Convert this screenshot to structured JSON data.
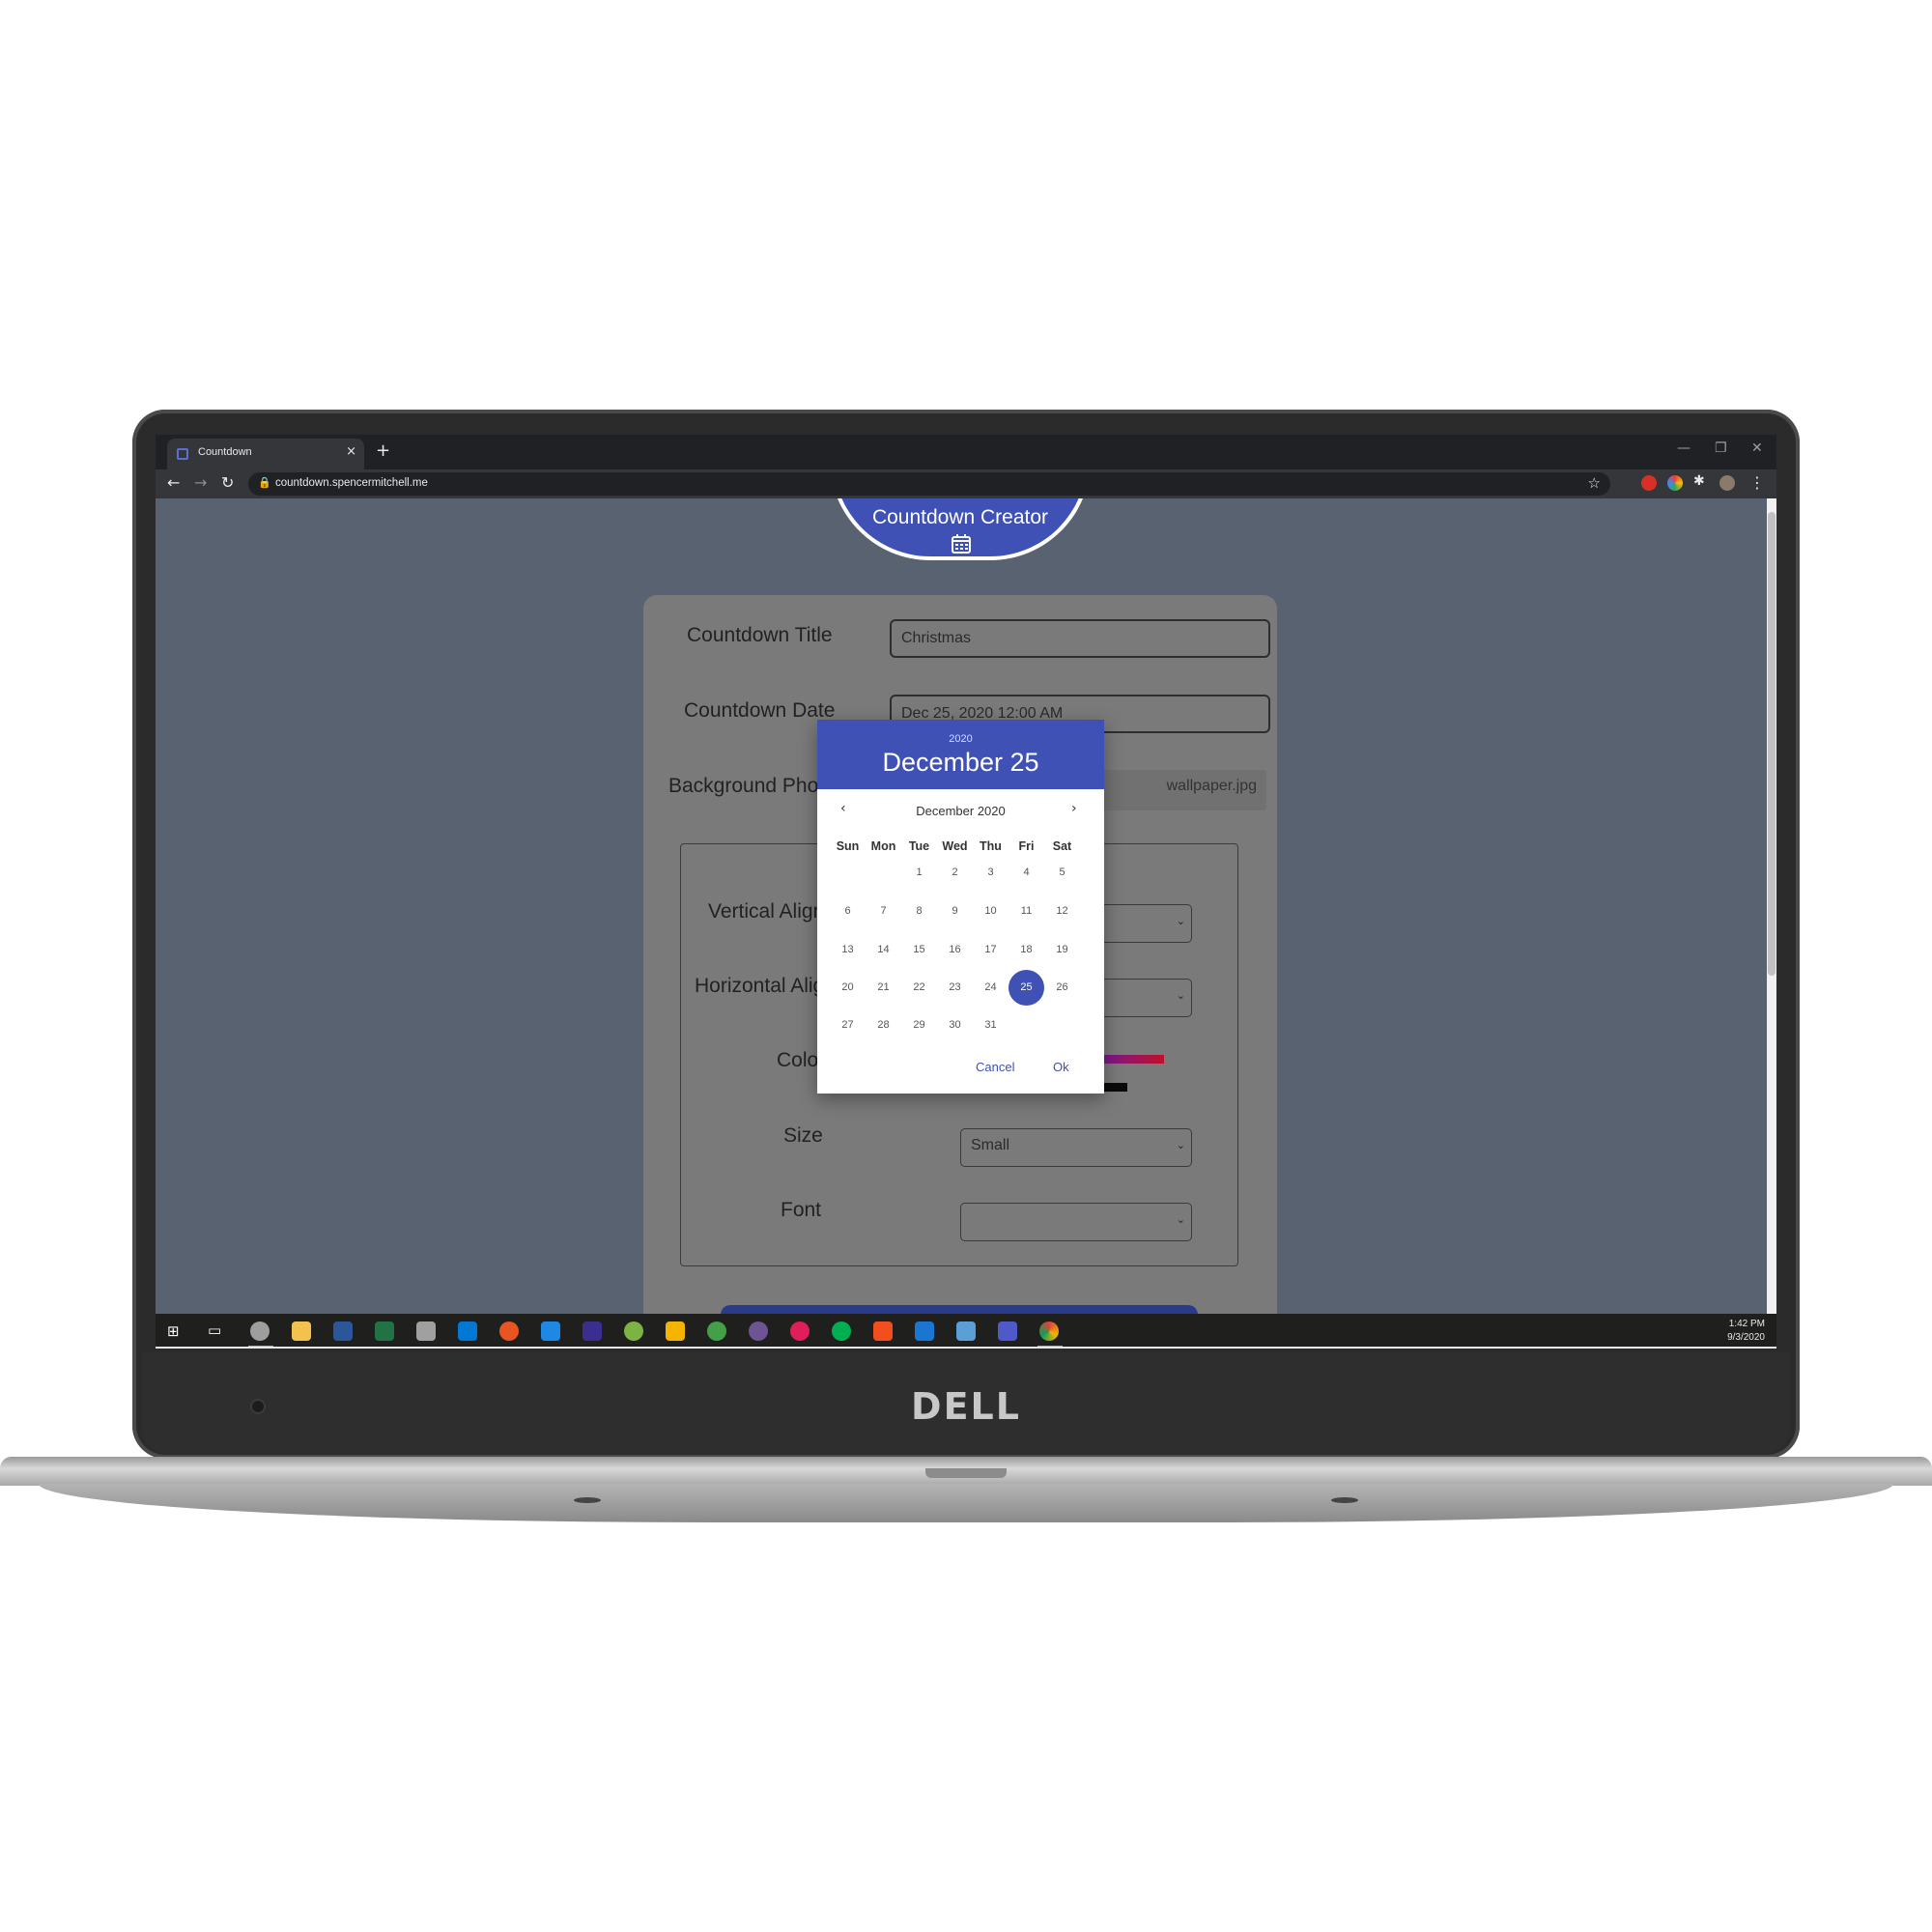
{
  "browser": {
    "tab_title": "Countdown",
    "tab_close": "×",
    "new_tab": "+",
    "url": "countdown.spencermitchell.me"
  },
  "page": {
    "header_title": "Countdown Creator",
    "title_label": "Countdown Title",
    "title_value": "Christmas",
    "date_label": "Countdown Date",
    "date_value": "Dec 25, 2020 12:00 AM",
    "bg_label": "Background Photo",
    "bg_value": "wallpaper.jpg",
    "valign_label": "Vertical Alignment",
    "halign_label": "Horizontal Alignment",
    "color_label": "Color",
    "size_label": "Size",
    "size_value": "Small",
    "font_label": "Font",
    "font_value": ""
  },
  "datepicker": {
    "year": "2020",
    "selected_date": "December 25",
    "month_label": "December 2020",
    "weekdays": [
      "Sun",
      "Mon",
      "Tue",
      "Wed",
      "Thu",
      "Fri",
      "Sat"
    ],
    "days": [
      "1",
      "2",
      "3",
      "4",
      "5",
      "6",
      "7",
      "8",
      "9",
      "10",
      "11",
      "12",
      "13",
      "14",
      "15",
      "16",
      "17",
      "18",
      "19",
      "20",
      "21",
      "22",
      "23",
      "24",
      "25",
      "26",
      "27",
      "28",
      "29",
      "30",
      "31"
    ],
    "first_weekday_index": 2,
    "selected_day": "25",
    "cancel_label": "Cancel",
    "ok_label": "Ok"
  },
  "taskbar": {
    "time": "1:42 PM",
    "date": "9/3/2020"
  },
  "laptop": {
    "brand": "DELL"
  },
  "colors": {
    "accent": "#3f51b5",
    "page_bg": "#596270",
    "card_bg": "#7a7a7a"
  }
}
